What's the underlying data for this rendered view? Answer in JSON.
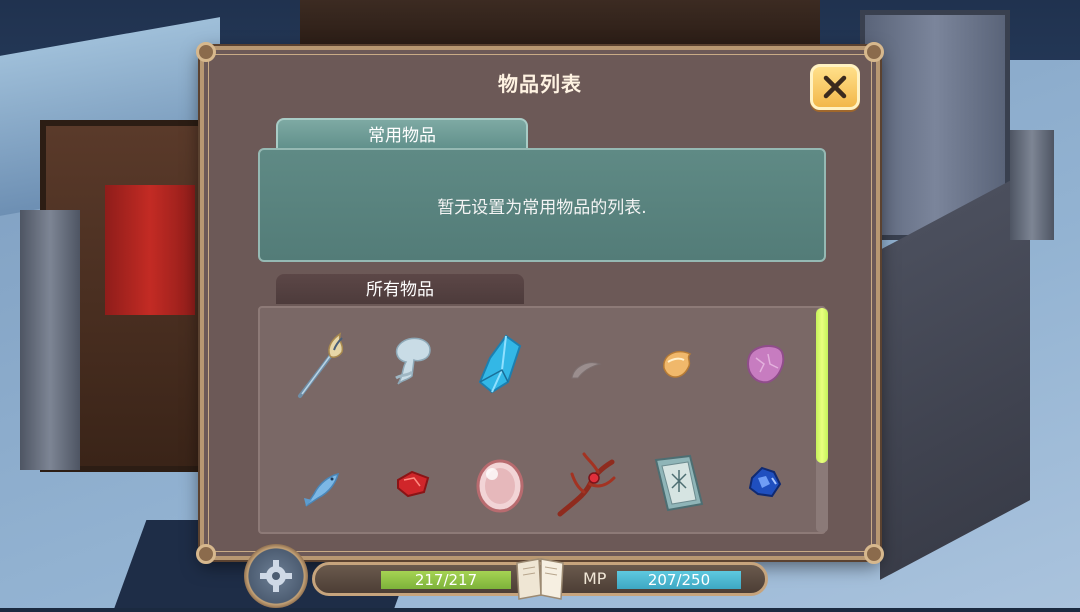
{
  "dialog": {
    "title": "物品列表",
    "close_icon": "close-icon"
  },
  "common_section": {
    "tab_label": "常用物品",
    "empty_message": "暂无设置为常用物品的列表."
  },
  "all_section": {
    "tab_label": "所有物品",
    "items": [
      {
        "icon": "magic-staff-icon"
      },
      {
        "icon": "ghost-spirit-icon"
      },
      {
        "icon": "blue-crystal-icon"
      },
      {
        "icon": "gray-feather-icon"
      },
      {
        "icon": "amber-shell-icon"
      },
      {
        "icon": "pink-stone-icon"
      },
      {
        "icon": "blue-fish-icon"
      },
      {
        "icon": "red-gem-icon"
      },
      {
        "icon": "glowing-orb-icon"
      },
      {
        "icon": "red-branch-icon"
      },
      {
        "icon": "spellbook-icon"
      },
      {
        "icon": "blue-ore-icon"
      }
    ],
    "scroll_position": 0.0,
    "scroll_visible_fraction": 0.69
  },
  "hud": {
    "hp_text": "217/217",
    "mp_label": "MP",
    "mp_text": "207/250",
    "hp_fraction": 1.0,
    "mp_fraction": 0.83
  },
  "colors": {
    "accent_close": "#f2b84a",
    "common_panel": "#5f8a85",
    "scrollbar": "#d6fa6a",
    "hp": "#8dc443",
    "mp": "#4fb8d1"
  }
}
